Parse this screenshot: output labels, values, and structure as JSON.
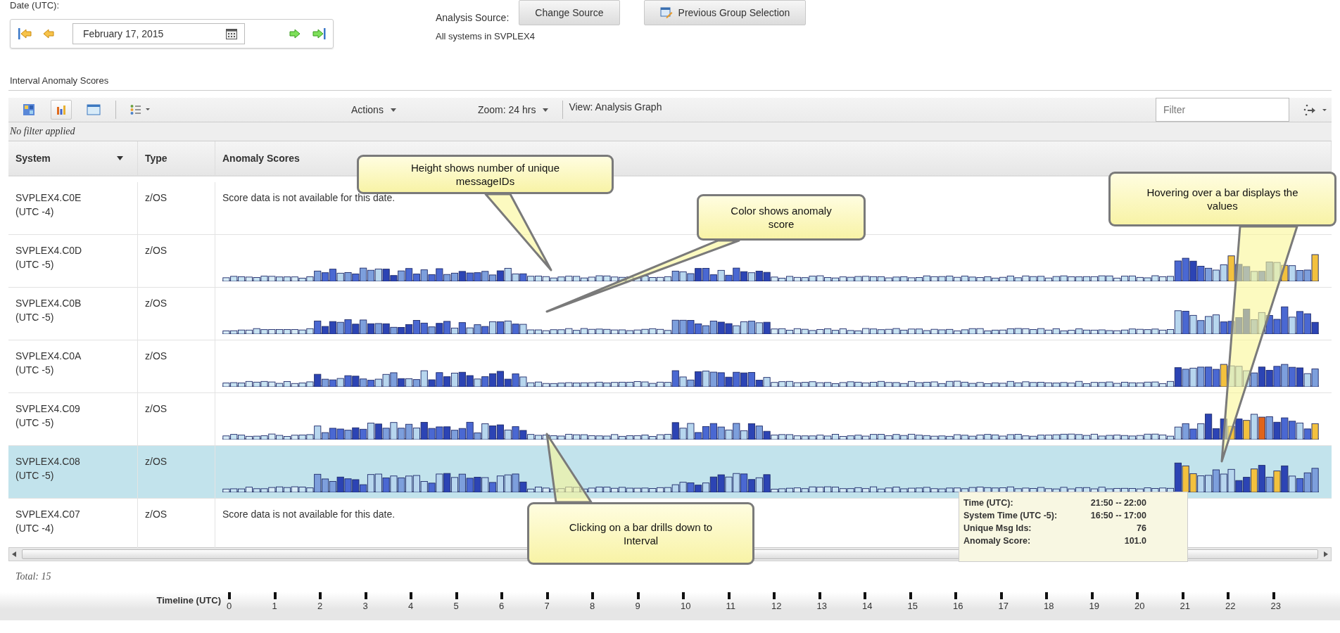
{
  "date_panel": {
    "label": "Date (UTC):",
    "date": "February 17, 2015"
  },
  "analysis_source": {
    "label": "Analysis Source:",
    "change_button": "Change Source",
    "previous_button": "Previous Group Selection",
    "description": "All systems in SVPLEX4"
  },
  "section_title": "Interval Anomaly Scores",
  "toolbar": {
    "views": [
      {
        "kind": "heatmap",
        "selected": false
      },
      {
        "kind": "bars",
        "selected": true
      },
      {
        "kind": "table",
        "selected": false
      }
    ],
    "actions": "Actions",
    "zoom": "Zoom: 24 hrs",
    "view": "View: Analysis Graph",
    "filter": {
      "placeholder": "Filter"
    }
  },
  "filter_status": "No filter applied",
  "table": {
    "columns": [
      "System",
      "Type",
      "Anomaly Scores"
    ],
    "rows": [
      {
        "system": "SVPLEX4.C0E",
        "offset": "(UTC -4)",
        "type": "z/OS",
        "kind": "message",
        "message": "Score data is not available for this date.",
        "selected": false
      },
      {
        "system": "SVPLEX4.C0D",
        "offset": "(UTC -5)",
        "type": "z/OS",
        "kind": "graph",
        "selected": false
      },
      {
        "system": "SVPLEX4.C0B",
        "offset": "(UTC -5)",
        "type": "z/OS",
        "kind": "graph",
        "selected": false
      },
      {
        "system": "SVPLEX4.C0A",
        "offset": "(UTC -5)",
        "type": "z/OS",
        "kind": "graph",
        "selected": false
      },
      {
        "system": "SVPLEX4.C09",
        "offset": "(UTC -5)",
        "type": "z/OS",
        "kind": "graph",
        "selected": false
      },
      {
        "system": "SVPLEX4.C08",
        "offset": "(UTC -5)",
        "type": "z/OS",
        "kind": "graph",
        "selected": true
      },
      {
        "system": "SVPLEX4.C07",
        "offset": "(UTC -4)",
        "type": "z/OS",
        "kind": "message",
        "message": "Score data is not available for this date.",
        "selected": false
      }
    ]
  },
  "tooltip": {
    "rows": [
      {
        "label": "Time (UTC):",
        "value": "21:50 -- 22:00"
      },
      {
        "label": "System Time (UTC -5):",
        "value": "16:50 -- 17:00"
      },
      {
        "label": "Unique Msg Ids:",
        "value": "76"
      },
      {
        "label": "Anomaly Score:",
        "value": "101.0"
      }
    ]
  },
  "callouts": [
    {
      "text": "Height shows number of unique messageIDs"
    },
    {
      "text": "Color shows anomaly score"
    },
    {
      "text": "Hovering over a bar displays the values"
    },
    {
      "text": "Clicking on a bar drills down to Interval"
    }
  ],
  "total": "Total: 15",
  "timeline": {
    "label": "Timeline (UTC)",
    "ticks": [
      "0",
      "1",
      "2",
      "3",
      "4",
      "5",
      "6",
      "7",
      "8",
      "9",
      "10",
      "11",
      "12",
      "13",
      "14",
      "15",
      "16",
      "17",
      "18",
      "19",
      "20",
      "21",
      "22",
      "23"
    ]
  }
}
